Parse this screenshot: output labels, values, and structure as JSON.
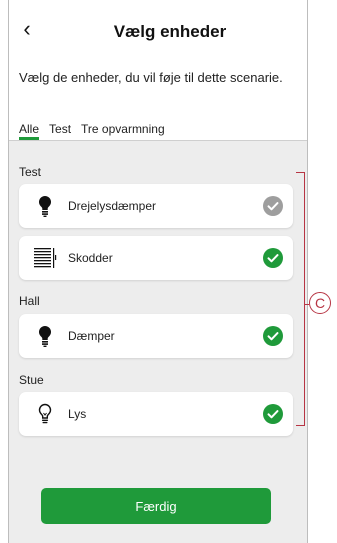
{
  "header": {
    "back_icon": "chevron-left-icon",
    "title": "Vælg enheder",
    "subtitle": "Vælg de enheder, du vil føje til dette scenarie."
  },
  "tabs": [
    {
      "label": "Alle",
      "active": true
    },
    {
      "label": "Test",
      "active": false
    },
    {
      "label": "Tre opvarmning",
      "active": false
    }
  ],
  "groups": [
    {
      "name": "Test",
      "devices": [
        {
          "label": "Drejelysdæmper",
          "icon": "bulb-dimmer-icon",
          "checked": true,
          "check_color": "#9e9e9e"
        },
        {
          "label": "Skodder",
          "icon": "shutter-icon",
          "checked": true,
          "check_color": "#1f9a3a"
        }
      ]
    },
    {
      "name": "Hall",
      "devices": [
        {
          "label": "Dæmper",
          "icon": "bulb-dimmer-icon",
          "checked": true,
          "check_color": "#1f9a3a"
        }
      ]
    },
    {
      "name": "Stue",
      "devices": [
        {
          "label": "Lys",
          "icon": "bulb-outline-icon",
          "checked": true,
          "check_color": "#1f9a3a"
        }
      ]
    }
  ],
  "callout": {
    "label": "C",
    "color": "#b73544"
  },
  "footer": {
    "done_label": "Færdig"
  },
  "colors": {
    "accent": "#1f9a3a",
    "disabled_check": "#9e9e9e"
  }
}
